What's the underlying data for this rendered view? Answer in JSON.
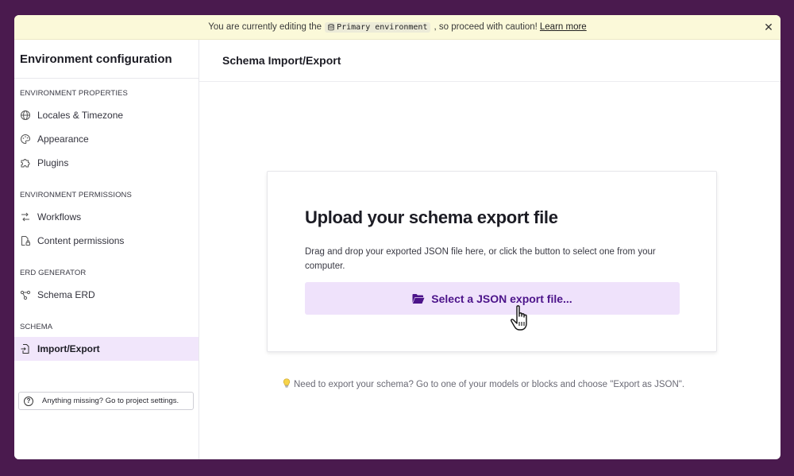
{
  "banner": {
    "text_before": "You are currently editing the",
    "env_name": "Primary environment",
    "text_after": ", so proceed with caution!",
    "link": "Learn more",
    "close_icon": "close-icon"
  },
  "sidebar": {
    "title": "Environment configuration",
    "sections": [
      {
        "label": "ENVIRONMENT PROPERTIES",
        "items": [
          {
            "label": "Locales & Timezone",
            "icon": "globe-icon"
          },
          {
            "label": "Appearance",
            "icon": "palette-icon"
          },
          {
            "label": "Plugins",
            "icon": "puzzle-icon"
          }
        ]
      },
      {
        "label": "ENVIRONMENT PERMISSIONS",
        "items": [
          {
            "label": "Workflows",
            "icon": "workflow-icon"
          },
          {
            "label": "Content permissions",
            "icon": "file-lock-icon"
          }
        ]
      },
      {
        "label": "ERD GENERATOR",
        "items": [
          {
            "label": "Schema ERD",
            "icon": "diagram-icon"
          }
        ]
      },
      {
        "label": "SCHEMA",
        "items": [
          {
            "label": "Import/Export",
            "icon": "file-import-icon",
            "active": true
          }
        ]
      }
    ],
    "missing_button": "Anything missing? Go to project settings."
  },
  "main": {
    "header_title": "Schema Import/Export",
    "card": {
      "heading": "Upload your schema export file",
      "description": "Drag and drop your exported JSON file here, or click the button to select one from your computer.",
      "button_label": "Select a JSON export file..."
    },
    "hint": "Need to export your schema? Go to one of your models or blocks and choose \"Export as JSON\"."
  },
  "colors": {
    "frame": "#4a1a4e",
    "banner_bg": "#fbf9d9",
    "accent_bg": "#efe2fb",
    "accent_text": "#4c148a",
    "active_nav": "#f1e6fb"
  }
}
